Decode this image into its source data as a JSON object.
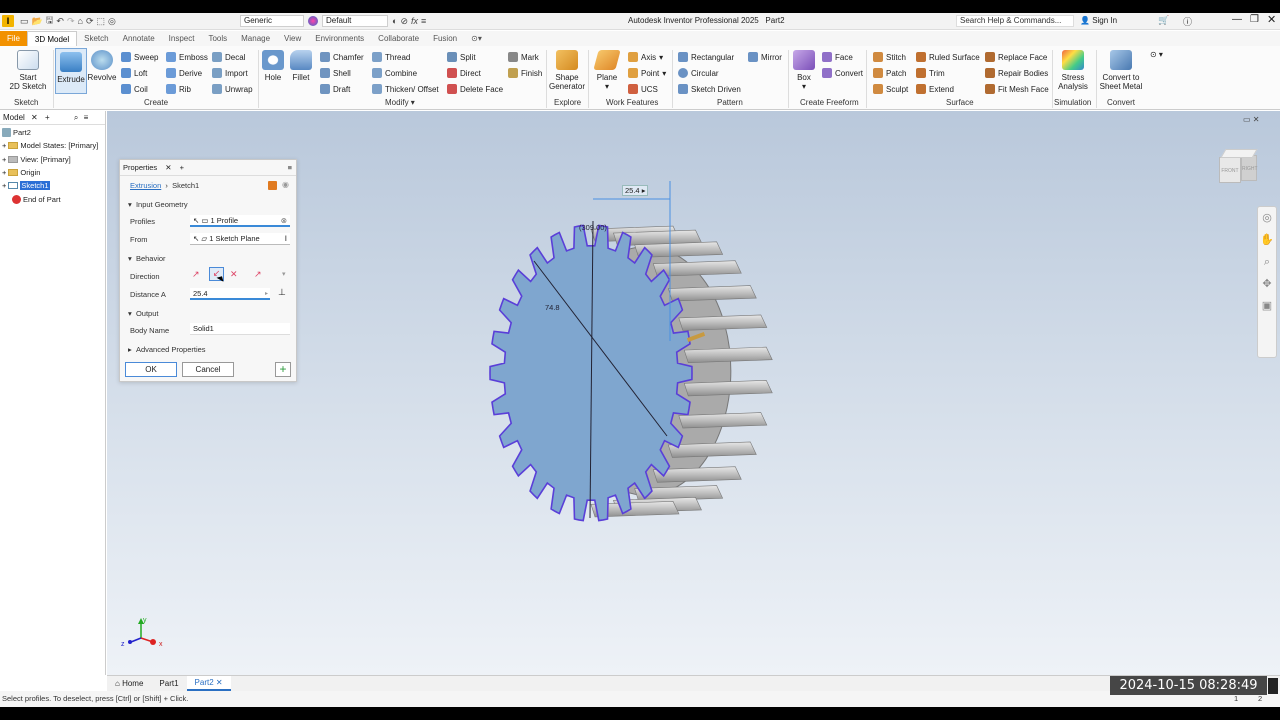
{
  "app": {
    "title": "Autodesk Inventor Professional 2025",
    "doc": "Part2",
    "appearance": "Generic",
    "style": "Default",
    "search_placeholder": "Search Help & Commands...",
    "sign_in": "Sign In"
  },
  "tabs": [
    "File",
    "3D Model",
    "Sketch",
    "Annotate",
    "Inspect",
    "Tools",
    "Manage",
    "View",
    "Environments",
    "Collaborate",
    "Fusion"
  ],
  "ribbon": {
    "sketch": {
      "start": "Start",
      "start2": "2D Sketch",
      "group": "Sketch"
    },
    "create": {
      "extrude": "Extrude",
      "revolve": "Revolve",
      "sweep": "Sweep",
      "emboss": "Emboss",
      "decal": "Decal",
      "loft": "Loft",
      "derive": "Derive",
      "import": "Import",
      "coil": "Coil",
      "rib": "Rib",
      "unwrap": "Unwrap",
      "group": "Create"
    },
    "modify": {
      "hole": "Hole",
      "fillet": "Fillet",
      "chamfer": "Chamfer",
      "thread": "Thread",
      "shell": "Shell",
      "combine": "Combine",
      "draft": "Draft",
      "thicken": "Thicken/ Offset",
      "split": "Split",
      "direct": "Direct",
      "delete_face": "Delete Face",
      "mark": "Mark",
      "finish": "Finish",
      "group": "Modify"
    },
    "explore": {
      "shape": "Shape",
      "generator": "Generator",
      "group": "Explore"
    },
    "work": {
      "plane": "Plane",
      "axis": "Axis",
      "point": "Point",
      "ucs": "UCS",
      "group": "Work Features"
    },
    "pattern": {
      "rect": "Rectangular",
      "circ": "Circular",
      "sketch_driven": "Sketch Driven",
      "mirror": "Mirror",
      "group": "Pattern"
    },
    "freeform": {
      "box": "Box",
      "face": "Face",
      "convert": "Convert",
      "group": "Create Freeform"
    },
    "surface": {
      "stitch": "Stitch",
      "patch": "Patch",
      "sculpt": "Sculpt",
      "ruled": "Ruled Surface",
      "trim": "Trim",
      "extend": "Extend",
      "replace": "Replace Face",
      "repair": "Repair Bodies",
      "fitmesh": "Fit Mesh Face",
      "group": "Surface"
    },
    "simulation": {
      "stress": "Stress",
      "analysis": "Analysis",
      "group": "Simulation"
    },
    "convert": {
      "c1": "Convert to",
      "c2": "Sheet Metal",
      "group": "Convert"
    }
  },
  "browser": {
    "tab": "Model",
    "items": [
      "Part2",
      "Model States: [Primary]",
      "View: [Primary]",
      "Origin",
      "Sketch1",
      "End of Part"
    ]
  },
  "properties": {
    "title": "Properties",
    "crumb1": "Extrusion",
    "crumb2": "Sketch1",
    "input_geometry": "Input Geometry",
    "profiles_label": "Profiles",
    "profiles_value": "1 Profile",
    "from_label": "From",
    "from_value": "1 Sketch Plane",
    "behavior": "Behavior",
    "direction_label": "Direction",
    "distance_label": "Distance A",
    "distance_value": "25.4",
    "output": "Output",
    "body_label": "Body Name",
    "body_value": "Solid1",
    "advanced": "Advanced Properties",
    "ok": "OK",
    "cancel": "Cancel"
  },
  "viewport": {
    "dim_top": "25.4",
    "dim_angle": "(309.00)",
    "dim_diag": "74.8",
    "cube_front": "FRONT",
    "cube_right": "RIGHT"
  },
  "doc_tabs": [
    "Home",
    "Part1",
    "Part2"
  ],
  "status": "Select profiles. To deselect, press [Ctrl] or [Shift] + Click.",
  "status_right": [
    "1",
    "2"
  ],
  "timestamp": "2024-10-15  08:28:49"
}
